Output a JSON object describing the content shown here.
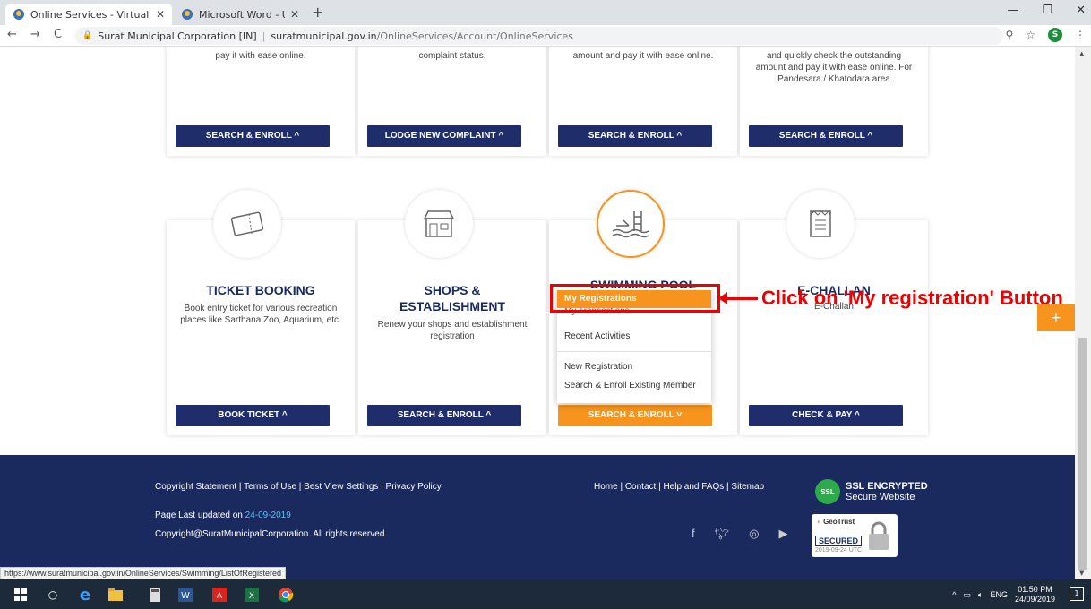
{
  "browser": {
    "tabs": [
      {
        "title": "Online Services - Virtual Civic Ce",
        "active": true
      },
      {
        "title": "Microsoft Word - User Manual fo",
        "active": false
      }
    ],
    "new_tab": "+",
    "url_site": "Surat Municipal Corporation [IN]",
    "url_domain": "suratmunicipal.gov.in",
    "url_path": "/OnlineServices/Account/OnlineServices",
    "profile_initial": "S"
  },
  "top_cards": [
    {
      "desc": "pay it with ease online.",
      "button": "SEARCH & ENROLL ^"
    },
    {
      "desc": "complaint status.",
      "button": "LODGE NEW COMPLAINT ^"
    },
    {
      "desc": "amount and pay it with ease online.",
      "button": "SEARCH & ENROLL ^"
    },
    {
      "desc": "and quickly check the outstanding amount and pay it with ease online. For Pandesara / Khatodara area",
      "button": "SEARCH & ENROLL ^"
    }
  ],
  "bottom_cards": [
    {
      "title": "TICKET BOOKING",
      "desc": "Book entry ticket for various recreation places like Sarthana Zoo, Aquarium, etc.",
      "button": "BOOK TICKET ^",
      "icon": "ticket-icon"
    },
    {
      "title_line1": "SHOPS &",
      "title_line2": "ESTABLISHMENT",
      "desc": "Renew your shops and establishment registration",
      "button": "SEARCH & ENROLL ^",
      "icon": "shop-icon"
    },
    {
      "title": "SWIMMING POOL",
      "button": "SEARCH & ENROLL ˅",
      "icon": "swimming-pool-icon"
    },
    {
      "title": "E-CHALLAN",
      "desc": "E-Challan",
      "button": "CHECK & PAY ^",
      "icon": "challan-icon"
    }
  ],
  "dropdown": {
    "items": [
      "My Registrations",
      "My Transactions",
      "Recent Activities",
      "New Registration",
      "Search & Enroll Existing Member"
    ]
  },
  "annotation": "Click on 'My registration' Button",
  "float_button": "+",
  "footer": {
    "links_left": "Copyright Statement  |  Terms of Use  |  Best View Settings  |  Privacy Policy",
    "links_right": "Home  |  Contact  |  Help and FAQs  |  Sitemap",
    "updated_label": "Page Last updated on ",
    "updated_date": "24-09-2019",
    "copyright": "Copyright@SuratMunicipalCorporation. All rights reserved.",
    "ssl_title": "SSL ENCRYPTED",
    "ssl_sub": "Secure Website",
    "ssl_badge": "SSL",
    "geotrust_brand": "GeoTrust",
    "geotrust_secured": "SECURED",
    "geotrust_date": "2019-09-24 UTC"
  },
  "status_url": "https://www.suratmunicipal.gov.in/OnlineServices/Swimming/ListOfRegistered",
  "taskbar": {
    "lang": "ENG",
    "time": "01:50 PM",
    "date": "24/09/2019",
    "notifications": "1"
  },
  "colors": {
    "navy": "#1f2e6b",
    "orange": "#f7941d",
    "annotation": "#ee0000"
  }
}
